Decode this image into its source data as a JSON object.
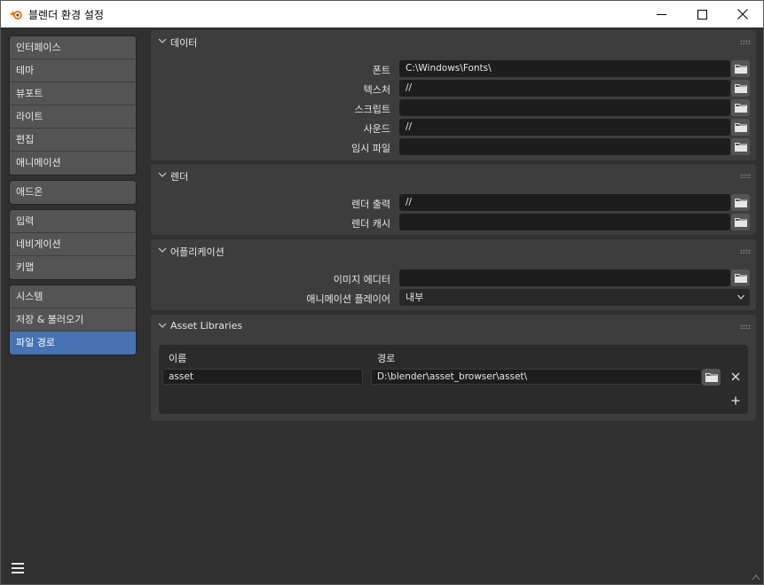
{
  "window": {
    "title": "블렌더 환경 설정",
    "minimize_icon": "minimize-icon",
    "maximize_icon": "maximize-icon",
    "close_icon": "close-icon"
  },
  "sidebar": {
    "groups": [
      [
        "인터페이스",
        "테마",
        "뷰포트",
        "라이트",
        "편집",
        "애니메이션"
      ],
      [
        "애드온"
      ],
      [
        "입력",
        "네비게이션",
        "키맵"
      ],
      [
        "시스템",
        "저장 & 불러오기",
        "파일 경로"
      ]
    ],
    "active": "파일 경로",
    "menu_icon": "hamburger-menu-icon"
  },
  "panels": {
    "data": {
      "title": "데이터",
      "rows": [
        {
          "label": "폰트",
          "value": "C:\\Windows\\Fonts\\"
        },
        {
          "label": "텍스처",
          "value": "//"
        },
        {
          "label": "스크립트",
          "value": ""
        },
        {
          "label": "사운드",
          "value": "//"
        },
        {
          "label": "임시 파일",
          "value": ""
        }
      ]
    },
    "render": {
      "title": "렌더",
      "rows": [
        {
          "label": "렌더 출력",
          "value": "//"
        },
        {
          "label": "렌더 캐시",
          "value": ""
        }
      ]
    },
    "applications": {
      "title": "어플리케이션",
      "image_editor_label": "이미지 에디터",
      "image_editor_value": "",
      "animation_player_label": "애니메이션 플레이어",
      "animation_player_value": "내부"
    },
    "asset_libraries": {
      "title": "Asset Libraries",
      "name_header": "이름",
      "path_header": "경로",
      "library_name": "asset",
      "library_path": "D:\\blender\\asset_browser\\asset\\",
      "remove_icon": "remove-x-icon",
      "add_icon": "add-plus-icon"
    }
  },
  "colors": {
    "accent": "#4772b3",
    "background": "#303030",
    "panel": "#3d3d3d",
    "field": "#1d1d1d"
  }
}
